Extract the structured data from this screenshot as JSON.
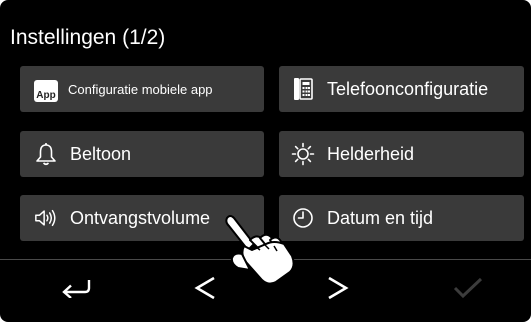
{
  "header": {
    "title": "Instellingen (1/2)"
  },
  "settings": {
    "mobile_app": {
      "label": "Configuratie mobiele app",
      "icon": "app-icon",
      "icon_text": "App"
    },
    "phone_config": {
      "label": "Telefoonconfiguratie",
      "icon": "phone-icon"
    },
    "ringtone": {
      "label": "Beltoon",
      "icon": "bell-icon"
    },
    "brightness": {
      "label": "Helderheid",
      "icon": "sun-icon"
    },
    "volume": {
      "label": "Ontvangstvolume",
      "icon": "speaker-icon"
    },
    "datetime": {
      "label": "Datum en tijd",
      "icon": "clock-icon"
    }
  },
  "navbar": {
    "back_icon": "back-arrow-icon",
    "prev_icon": "chevron-left-icon",
    "next_icon": "chevron-right-icon",
    "confirm_icon": "checkmark-icon"
  },
  "colors": {
    "background": "#000000",
    "button": "#3a3a3a",
    "text": "#ffffff",
    "disabled": "#3c3c3c"
  }
}
